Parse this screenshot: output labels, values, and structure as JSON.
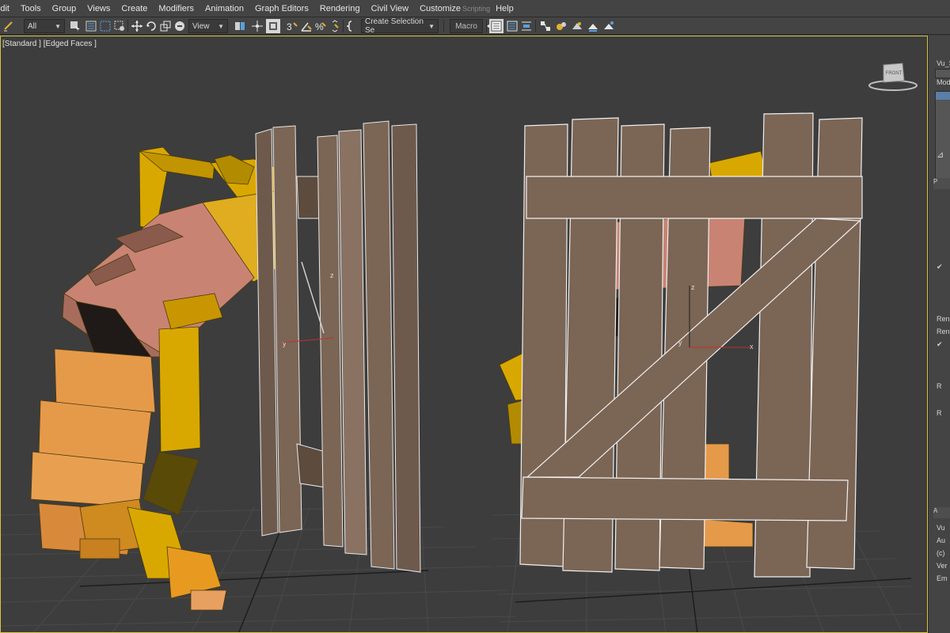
{
  "menu": {
    "items": [
      "Edit",
      "Tools",
      "Group",
      "Views",
      "Create",
      "Modifiers",
      "Animation",
      "Graph Editors",
      "Rendering",
      "Civil View",
      "Customize"
    ],
    "faded_item": "Scripting",
    "help": "Help"
  },
  "toolbar": {
    "filter_value": "All",
    "refcoord_value": "View",
    "selection_set_value": "Create Selection Se",
    "macro_label": "Macro"
  },
  "viewport": {
    "label": "[Standard ] [Edged Faces ]",
    "viewcube_label": "FRONT",
    "accent_color": "#d9c341",
    "axis_label_z": "z",
    "axis_label_y": "y",
    "axis_label_z2": "z",
    "axis_label_y2": "y",
    "axis_label_x2": "x"
  },
  "command_panel": {
    "object_name": "Vu_S",
    "modifier_label": "Modi",
    "rollout_labels": [
      "P",
      "A"
    ],
    "list_items": [
      "Ren",
      "Ren",
      "Vu",
      "Au",
      "(c)",
      "Ver",
      "Em"
    ],
    "short_labels": [
      "R",
      "R",
      "R"
    ]
  },
  "colors": {
    "fence_wood": "#7b6555",
    "robot_yellow": "#d9a800",
    "robot_orange": "#e59a4a",
    "robot_pink": "#c98373",
    "grid": "#4a4a4a"
  }
}
